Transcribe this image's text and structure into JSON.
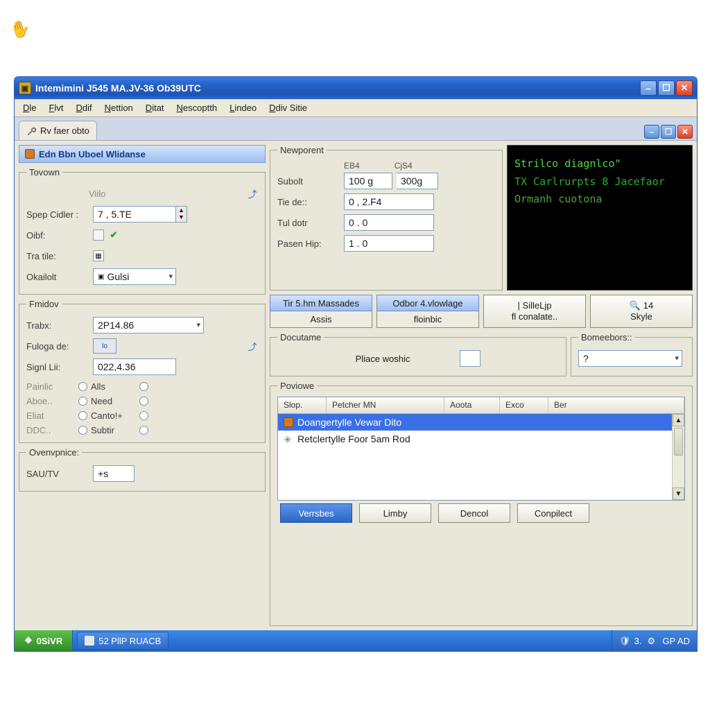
{
  "window": {
    "title": "Intemimini J545 MA.JV-36 Ob39UTC"
  },
  "menubar": [
    "Dle",
    "Flvt",
    "Ddif",
    "Nettion",
    "Ditat",
    "Nescoptth",
    "Lindeo",
    "Ddiv Sitie"
  ],
  "tab": {
    "label": "Rv faer obto"
  },
  "left": {
    "header": "Edn Bbn Uboel Wlidanse",
    "tovown": {
      "legend": "Tovown",
      "viilo": "Viilo",
      "spep_label": "Spep Cidler :",
      "spep_value": "7 , 5.TE",
      "oibf_label": "Oibf:",
      "tra_label": "Tra tile:",
      "okailolt_label": "Okailolt",
      "okailolt_value": "Gulsi"
    },
    "fmidov": {
      "legend": "Fmidov",
      "trabx_label": "Trabx:",
      "trabx_value": "2P14.86",
      "fuloga_label": "Fuloga de:",
      "fuloga_box": "lo",
      "signl_label": "Signl Lii:",
      "signl_value": "022,4.36",
      "radios": [
        {
          "left": "Painlic",
          "right": "Alls"
        },
        {
          "left": "Aboe..",
          "right": "Need"
        },
        {
          "left": "Eliat",
          "right": "Canto!+"
        },
        {
          "left": "DDC..",
          "right": "Subtir"
        }
      ]
    },
    "oven": {
      "legend": "Ovenvpnice:",
      "sautv_label": "SAU/TV",
      "sautv_value": "+s"
    }
  },
  "right": {
    "newporent": {
      "legend": "Newporent",
      "col1": "EB4",
      "col2": "CjS4",
      "subolt_label": "Subolt",
      "subolt_v1": "100 g",
      "subolt_v2": "300g",
      "tiede_label": "Tie de::",
      "tiede_value": "0 , 2.F4",
      "tuldotr_label": "Tul dotr",
      "tuldotr_value": "0 . 0",
      "pasenhip_label": "Pasen Hip:",
      "pasenhip_value": "1 . 0"
    },
    "terminal": [
      "Strilco diagnlco\"",
      "TX Carlrurpts 8 Jacefaor",
      "Ormanh cuotona"
    ],
    "buttons": [
      {
        "top": "Tir 5.hm Massades",
        "bot": "Assis"
      },
      {
        "top": "Odbor 4.vlowlage",
        "bot": "floinbic"
      },
      {
        "top": "| SilleLjp",
        "bot": "fl conalate.."
      },
      {
        "top": "14",
        "bot": "Skyle"
      }
    ],
    "docutame": {
      "legend": "Docutame",
      "label": "Pliace woshic"
    },
    "bomee": {
      "legend": "Bomeebors::",
      "value": "?"
    },
    "poviowe": {
      "legend": "Poviowe",
      "columns": [
        "Slop.",
        "Petcher MN",
        "Aoota",
        "Exco",
        "Ber"
      ],
      "items": [
        "Doangertylle Vewar Dito",
        "Retclertylle Foor 5am Rod"
      ]
    },
    "footer": [
      "Verrsbes",
      "Limby",
      "Dencol",
      "Conpilect"
    ]
  },
  "taskbar": {
    "start": "0SiVR",
    "item": "52 PllP RUACB",
    "tray": "3.",
    "gpad": "GP AD"
  }
}
